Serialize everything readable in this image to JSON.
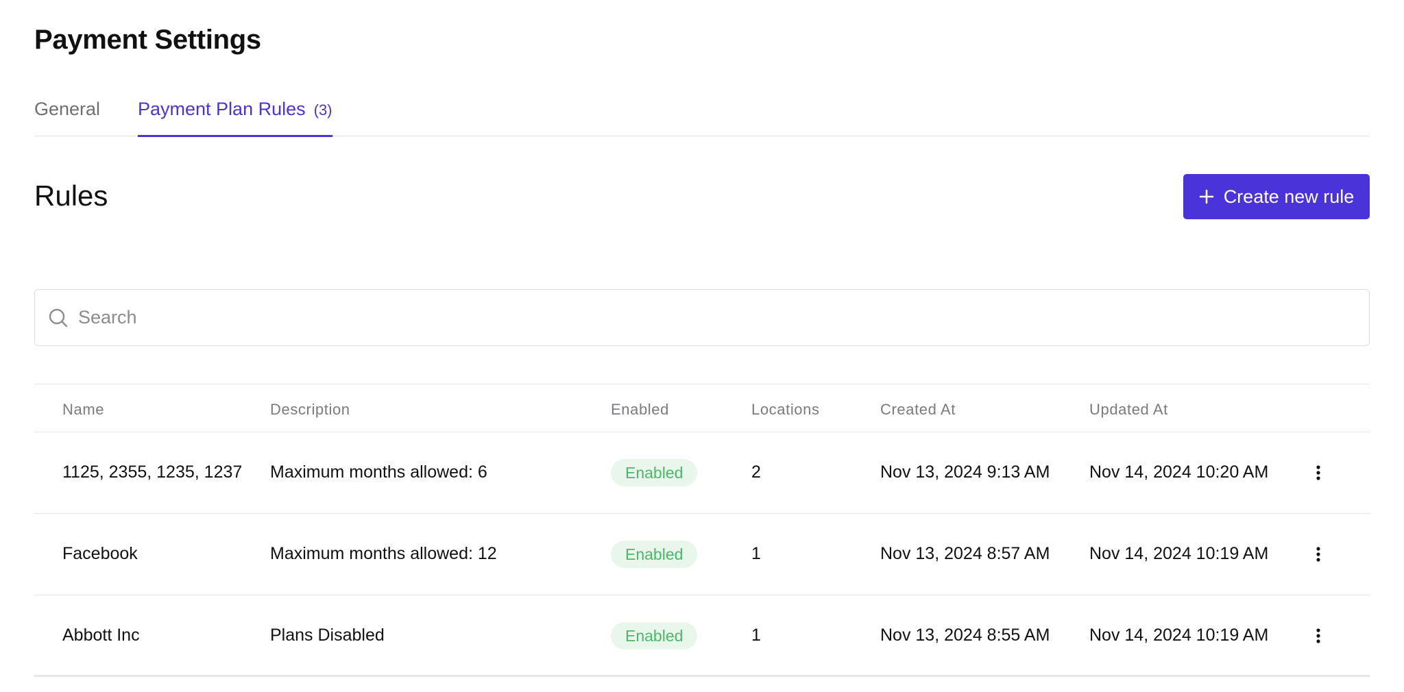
{
  "page": {
    "title": "Payment Settings"
  },
  "tabs": [
    {
      "label": "General"
    },
    {
      "label": "Payment Plan Rules",
      "count": "(3)"
    }
  ],
  "section": {
    "title": "Rules"
  },
  "toolbar": {
    "create_label": "Create new rule"
  },
  "search": {
    "placeholder": "Search",
    "value": ""
  },
  "table": {
    "headers": [
      "Name",
      "Description",
      "Enabled",
      "Locations",
      "Created At",
      "Updated At"
    ],
    "rows": [
      {
        "name": "1125, 2355, 1235, 1237",
        "description": "Maximum months allowed: 6",
        "enabled": "Enabled",
        "locations": "2",
        "created_at": "Nov 13, 2024 9:13 AM",
        "updated_at": "Nov 14, 2024 10:20 AM"
      },
      {
        "name": "Facebook",
        "description": "Maximum months allowed: 12",
        "enabled": "Enabled",
        "locations": "1",
        "created_at": "Nov 13, 2024 8:57 AM",
        "updated_at": "Nov 14, 2024 10:19 AM"
      },
      {
        "name": "Abbott Inc",
        "description": "Plans Disabled",
        "enabled": "Enabled",
        "locations": "1",
        "created_at": "Nov 13, 2024 8:55 AM",
        "updated_at": "Nov 14, 2024 10:19 AM"
      }
    ]
  },
  "colors": {
    "accent": "#4a33d8",
    "badge_bg": "#e9f6ec",
    "badge_text": "#4fb56b"
  },
  "icons": {
    "create": "plus-icon",
    "search": "search-icon",
    "row_menu": "more-vertical-icon"
  }
}
